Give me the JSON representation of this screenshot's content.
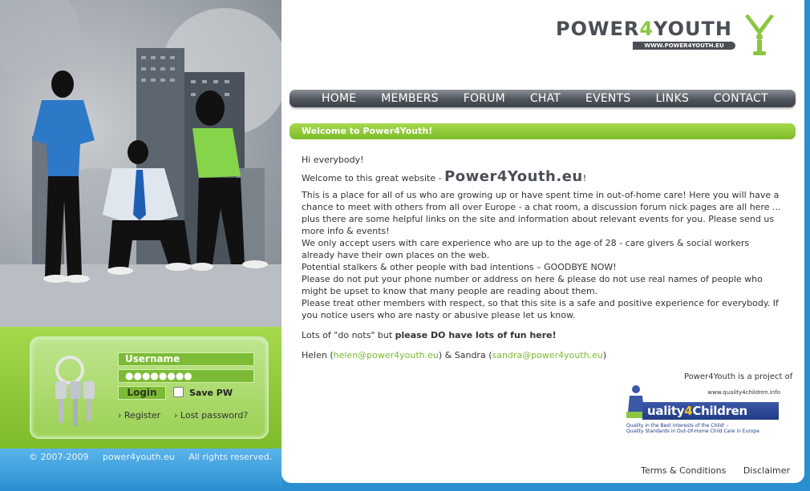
{
  "header": {
    "logo_main": "POWER",
    "logo_four": "4",
    "logo_end": "YOUTH",
    "logo_url": "WWW.POWER4YOUTH.EU"
  },
  "nav": {
    "items": [
      "HOME",
      "MEMBERS",
      "FORUM",
      "CHAT",
      "EVENTS",
      "LINKS",
      "CONTACT"
    ]
  },
  "welcome": {
    "title": "Welcome to Power4Youth!",
    "greeting": "Hi everybody!",
    "intro_prefix": "Welcome to this great website - ",
    "intro_brand": "Power4Youth.eu",
    "intro_suffix": "!",
    "paragraphs": [
      "This is a place for all of us who are growing up or have spent time in out-of-home care! Here you will have a chance to meet with others from all over Europe - a chat room, a discussion forum nick pages are all here ... plus there are some helpful links on the site and information about relevant events for you. Please send us more info & events!",
      "We only accept users with care experience who are up to the age of 28 - care givers & social workers already have their own places on the web.",
      "Potential stalkers & other people with bad intentions – GOODBYE NOW!",
      "Please do not put your phone number or address on here & please do not use real names of people who might be upset to know that many people are reading about them.",
      "Please treat other members with respect, so that this site is a safe and positive experience for everybody. If you notice users who are nasty or abusive please let us know."
    ],
    "fun_prefix": "Lots of \"do nots\" but ",
    "fun_bold": "please DO have lots of fun here!",
    "sig_name1": "Helen (",
    "sig_email1": "helen@power4youth.eu",
    "sig_mid": ") & Sandra (",
    "sig_email2": "sandra@power4youth.eu",
    "sig_end": ")"
  },
  "partner": {
    "project_of": "Power4Youth is a project of",
    "url": "www.quality4children.info",
    "name_a": "uality",
    "name_b": "4",
    "name_c": "Children",
    "tagline1": "Quality in the Best Interests of the Child! –",
    "tagline2": "Quality Standards in Out-Of-Home Child Care in Europe"
  },
  "login": {
    "username_placeholder": "Username",
    "password_value": "●●●●●●●●",
    "login_label": "Login",
    "savepw_label": "Save PW",
    "register_label": "Register",
    "lost_label": "Lost password?"
  },
  "footer": {
    "copyright": "© 2007-2009",
    "site": "power4youth.eu",
    "rights": "All rights reserved.",
    "terms": "Terms & Conditions",
    "disclaimer": "Disclaimer"
  },
  "colors": {
    "accent_green": "#8cc63f",
    "nav_dark": "#4f555c",
    "link_green": "#7cb934",
    "footer_blue": "#2a8fd0"
  }
}
